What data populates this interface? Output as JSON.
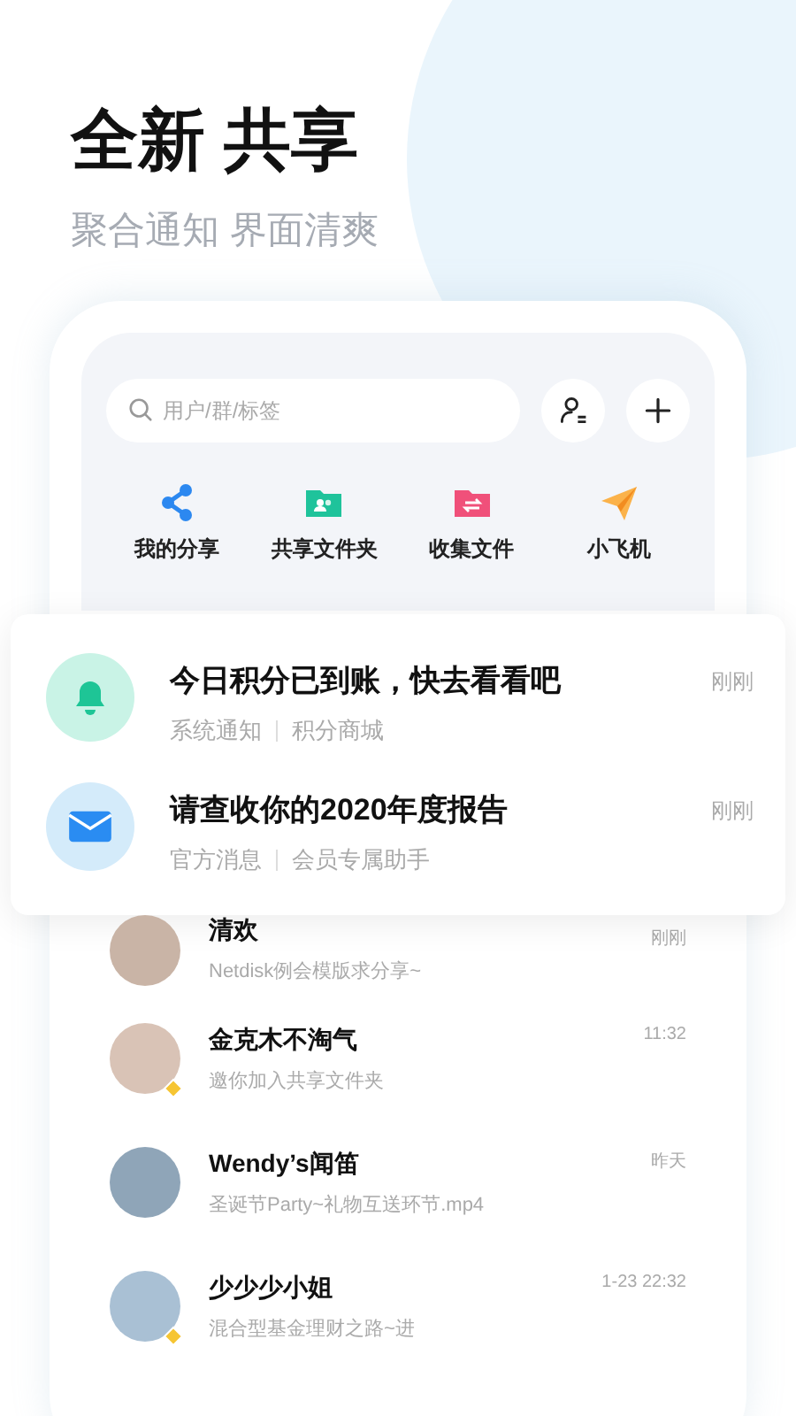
{
  "hero": {
    "title": "全新 共享",
    "subtitle": "聚合通知 界面清爽"
  },
  "search": {
    "placeholder": "用户/群/标签"
  },
  "shortcuts": [
    {
      "label": "我的分享",
      "kind": "share"
    },
    {
      "label": "共享文件夹",
      "kind": "shared-folder"
    },
    {
      "label": "收集文件",
      "kind": "collect-folder"
    },
    {
      "label": "小飞机",
      "kind": "plane"
    }
  ],
  "notifications": [
    {
      "kind": "bell",
      "title": "今日积分已到账，快去看看吧",
      "source": "系统通知",
      "category": "积分商城",
      "time": "刚刚"
    },
    {
      "kind": "mail",
      "title": "请查收你的2020年度报告",
      "source": "官方消息",
      "category": "会员专属助手",
      "time": "刚刚"
    }
  ],
  "chats": [
    {
      "name": "清欢",
      "preview": "Netdisk例会模版求分享~",
      "time": "刚刚",
      "vip": false
    },
    {
      "name": "金克木不淘气",
      "preview": "邀你加入共享文件夹",
      "time": "11:32",
      "vip": true
    },
    {
      "name": "Wendy’s闻笛",
      "preview": "圣诞节Party~礼物互送环节.mp4",
      "time": "昨天",
      "vip": false
    },
    {
      "name": "少少少小姐",
      "preview": "混合型基金理财之路~进",
      "time": "1-23  22:32",
      "vip": true
    }
  ]
}
